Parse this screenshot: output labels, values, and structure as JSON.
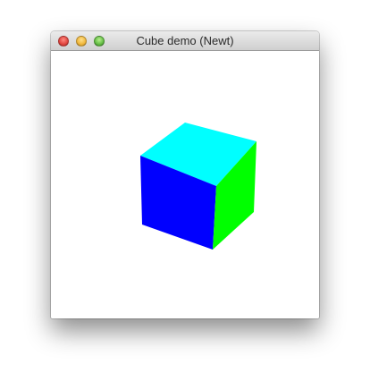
{
  "window": {
    "title": "Cube demo (Newt)"
  },
  "controls": {
    "close": "close-button",
    "minimize": "minimize-button",
    "zoom": "zoom-button"
  },
  "scene": {
    "background": "#ffffff",
    "cube_faces": {
      "top": "#00ffff",
      "front": "#0000ff",
      "side": "#00ff00"
    }
  }
}
